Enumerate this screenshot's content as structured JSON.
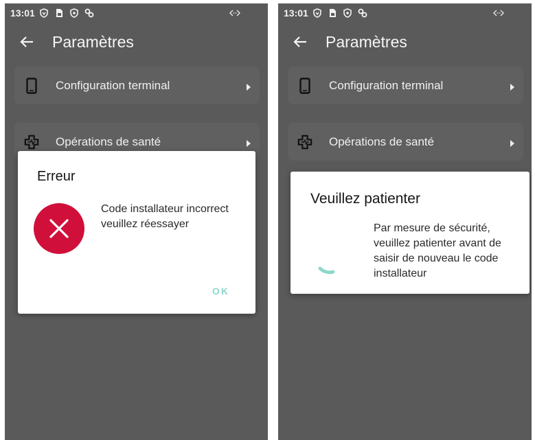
{
  "screens": [
    {
      "status_bar": {
        "time": "13:01"
      },
      "app_bar": {
        "title": "Paramètres"
      },
      "menu": [
        {
          "label": "Configuration terminal",
          "icon": "phone-icon"
        },
        {
          "label": "Opérations de santé",
          "icon": "health-cross-icon"
        }
      ],
      "dialog": {
        "title": "Erreur",
        "message": "Code installateur incorrect veuillez réessayer",
        "ok_label": "OK",
        "icon": "error-x-icon"
      }
    },
    {
      "status_bar": {
        "time": "13:01"
      },
      "app_bar": {
        "title": "Paramètres"
      },
      "menu": [
        {
          "label": "Configuration terminal",
          "icon": "phone-icon"
        },
        {
          "label": "Opérations de santé",
          "icon": "health-cross-icon"
        }
      ],
      "dialog": {
        "title": "Veuillez patienter",
        "message": "Par mesure de sécurité, veuillez patienter avant de saisir de nouveau le code installateur",
        "icon": "loading-spinner-icon"
      }
    }
  ],
  "colors": {
    "background": "#5a5a5a",
    "card": "#606060",
    "error_red": "#d0103a",
    "accent_teal": "#8fd8cb"
  }
}
